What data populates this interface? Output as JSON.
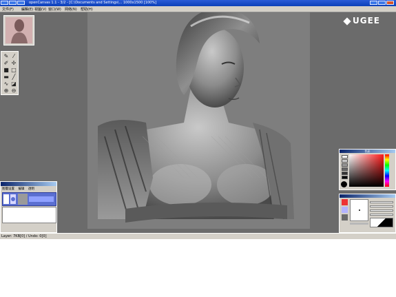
{
  "window": {
    "title": "openCanvas 1.1 - 3/2 - [C:\\Documents and Settings\\... 1000x1500 [100%]"
  },
  "menu": [
    {
      "label": "文件(F)"
    },
    {
      "label": "編輯(E)"
    },
    {
      "label": "視圖(V)"
    },
    {
      "label": "窗口(W)"
    },
    {
      "label": "网络(N)"
    },
    {
      "label": "帮助(H)"
    }
  ],
  "logo": {
    "text": "UGEE"
  },
  "layer_panel": {
    "tabs": [
      "图層设置",
      "编辑",
      "透明"
    ]
  },
  "color_panel": {
    "title": "色彩",
    "swatches": [
      "#ffffff",
      "#cccccc",
      "#999999",
      "#666666",
      "#333333",
      "#000000"
    ],
    "hue_color": "#ff1a1a"
  },
  "status": {
    "text": "Layer: 7KB[0] / Undo: 0[0]"
  },
  "colors": {
    "workspace": "#6b6b6b",
    "canvas": "#7e7e7e",
    "title_bar": "#0b3fb8",
    "panel": "#d4d0c8"
  }
}
